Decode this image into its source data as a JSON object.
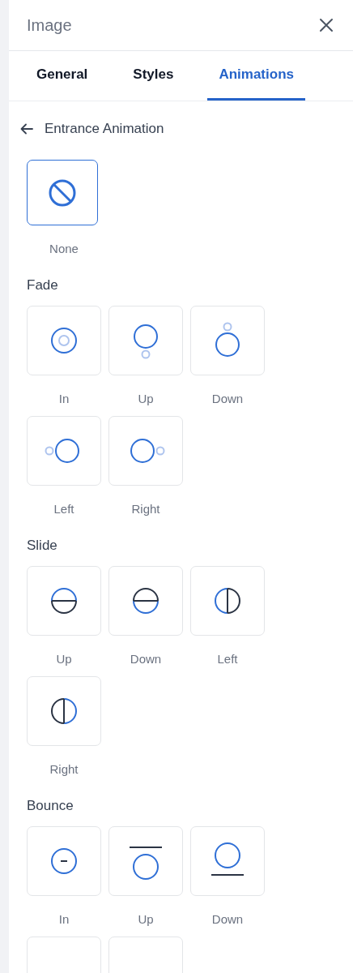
{
  "panel": {
    "title": "Image"
  },
  "tabs": [
    {
      "label": "General",
      "selected": false
    },
    {
      "label": "Styles",
      "selected": false
    },
    {
      "label": "Animations",
      "selected": true
    }
  ],
  "back": {
    "label": "Entrance Animation"
  },
  "none_option": {
    "kind": "none",
    "label": "None",
    "selected": true
  },
  "groups": [
    {
      "title": "Fade",
      "items": [
        {
          "kind": "fade-in",
          "label": "In",
          "selected": false
        },
        {
          "kind": "fade-up",
          "label": "Up",
          "selected": false
        },
        {
          "kind": "fade-down",
          "label": "Down",
          "selected": false
        },
        {
          "kind": "fade-left",
          "label": "Left",
          "selected": false
        },
        {
          "kind": "fade-right",
          "label": "Right",
          "selected": false
        }
      ]
    },
    {
      "title": "Slide",
      "items": [
        {
          "kind": "slide-up",
          "label": "Up",
          "selected": false
        },
        {
          "kind": "slide-down",
          "label": "Down",
          "selected": false
        },
        {
          "kind": "slide-left",
          "label": "Left",
          "selected": false
        },
        {
          "kind": "slide-right",
          "label": "Right",
          "selected": false
        }
      ]
    },
    {
      "title": "Bounce",
      "items": [
        {
          "kind": "bounce-in",
          "label": "In",
          "selected": false
        },
        {
          "kind": "bounce-up",
          "label": "Up",
          "selected": false
        },
        {
          "kind": "bounce-down",
          "label": "Down",
          "selected": false
        },
        {
          "kind": "cut",
          "selected": false
        },
        {
          "kind": "cut",
          "selected": false
        }
      ]
    }
  ]
}
